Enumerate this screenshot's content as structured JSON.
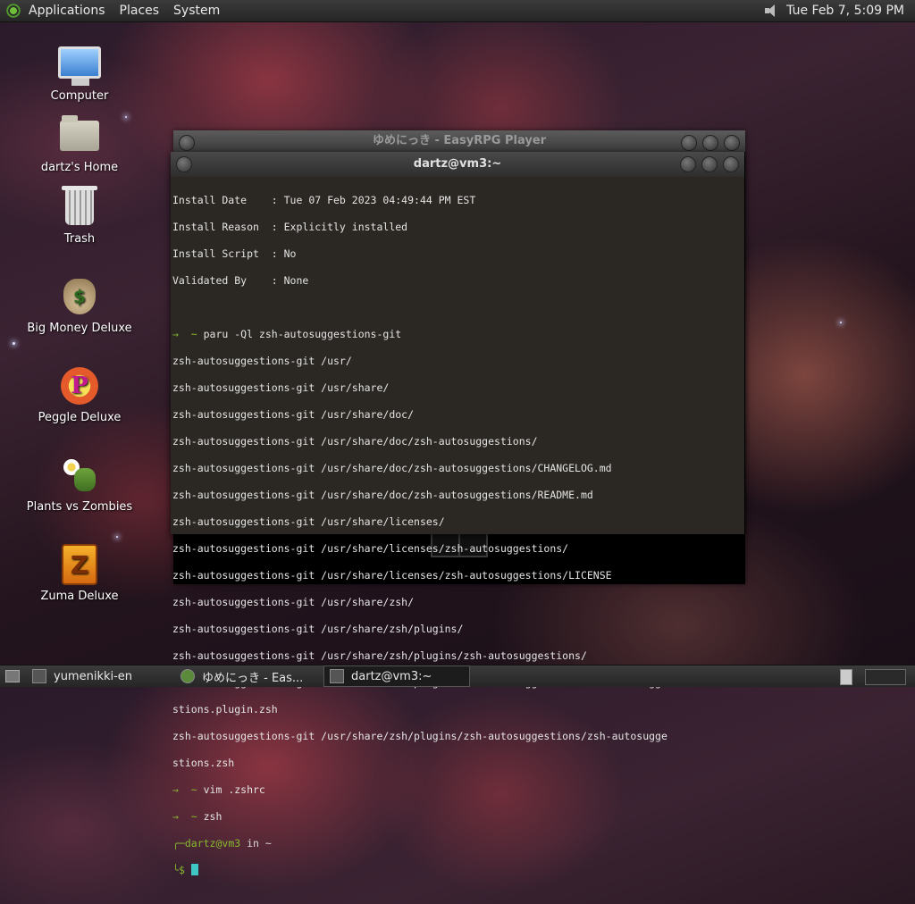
{
  "top_panel": {
    "menu": [
      "Applications",
      "Places",
      "System"
    ],
    "clock": "Tue Feb  7,  5:09 PM"
  },
  "desktop_icons": [
    {
      "label": "Computer",
      "icon": "computer-icon"
    },
    {
      "label": "dartz's Home",
      "icon": "home-folder-icon"
    },
    {
      "label": "Trash",
      "icon": "trash-icon"
    },
    {
      "label": "Big Money Deluxe",
      "icon": "money-bag-icon"
    },
    {
      "label": "Peggle Deluxe",
      "icon": "peggle-icon"
    },
    {
      "label": "Plants vs Zombies",
      "icon": "plant-icon"
    },
    {
      "label": "Zuma Deluxe",
      "icon": "zuma-icon"
    }
  ],
  "back_window": {
    "title": "ゆめにっき - EasyRPG Player"
  },
  "terminal": {
    "title": "dartz@vm3:~",
    "lines": [
      "Install Date    : Tue 07 Feb 2023 04:49:44 PM EST",
      "Install Reason  : Explicitly installed",
      "Install Script  : No",
      "Validated By    : None",
      "",
      "paru -Ql zsh-autosuggestions-git",
      "zsh-autosuggestions-git /usr/",
      "zsh-autosuggestions-git /usr/share/",
      "zsh-autosuggestions-git /usr/share/doc/",
      "zsh-autosuggestions-git /usr/share/doc/zsh-autosuggestions/",
      "zsh-autosuggestions-git /usr/share/doc/zsh-autosuggestions/CHANGELOG.md",
      "zsh-autosuggestions-git /usr/share/doc/zsh-autosuggestions/README.md",
      "zsh-autosuggestions-git /usr/share/licenses/",
      "zsh-autosuggestions-git /usr/share/licenses/zsh-autosuggestions/",
      "zsh-autosuggestions-git /usr/share/licenses/zsh-autosuggestions/LICENSE",
      "zsh-autosuggestions-git /usr/share/zsh/",
      "zsh-autosuggestions-git /usr/share/zsh/plugins/",
      "zsh-autosuggestions-git /usr/share/zsh/plugins/zsh-autosuggestions/",
      "zsh-autosuggestions-git /usr/share/zsh/plugins/zsh-autosuggestions/zsh-autosugge",
      "stions.plugin.zsh",
      "zsh-autosuggestions-git /usr/share/zsh/plugins/zsh-autosuggestions/zsh-autosugge",
      "stions.zsh",
      "vim .zshrc",
      "zsh"
    ],
    "prompt_arrow": "→  ~ ",
    "prompt_user": "dartz@vm3",
    "prompt_in": " in ~",
    "prompt_dollar": "$ "
  },
  "taskbar": {
    "tasks": [
      {
        "label": "yumenikki-en",
        "active": false
      },
      {
        "label": "ゆめにっき - Eas...",
        "active": false
      },
      {
        "label": "dartz@vm3:~",
        "active": true
      }
    ]
  },
  "colors": {
    "prompt_green": "#88b92f",
    "cursor": "#3ec7c4",
    "terminal_bg": "#2b2823"
  }
}
